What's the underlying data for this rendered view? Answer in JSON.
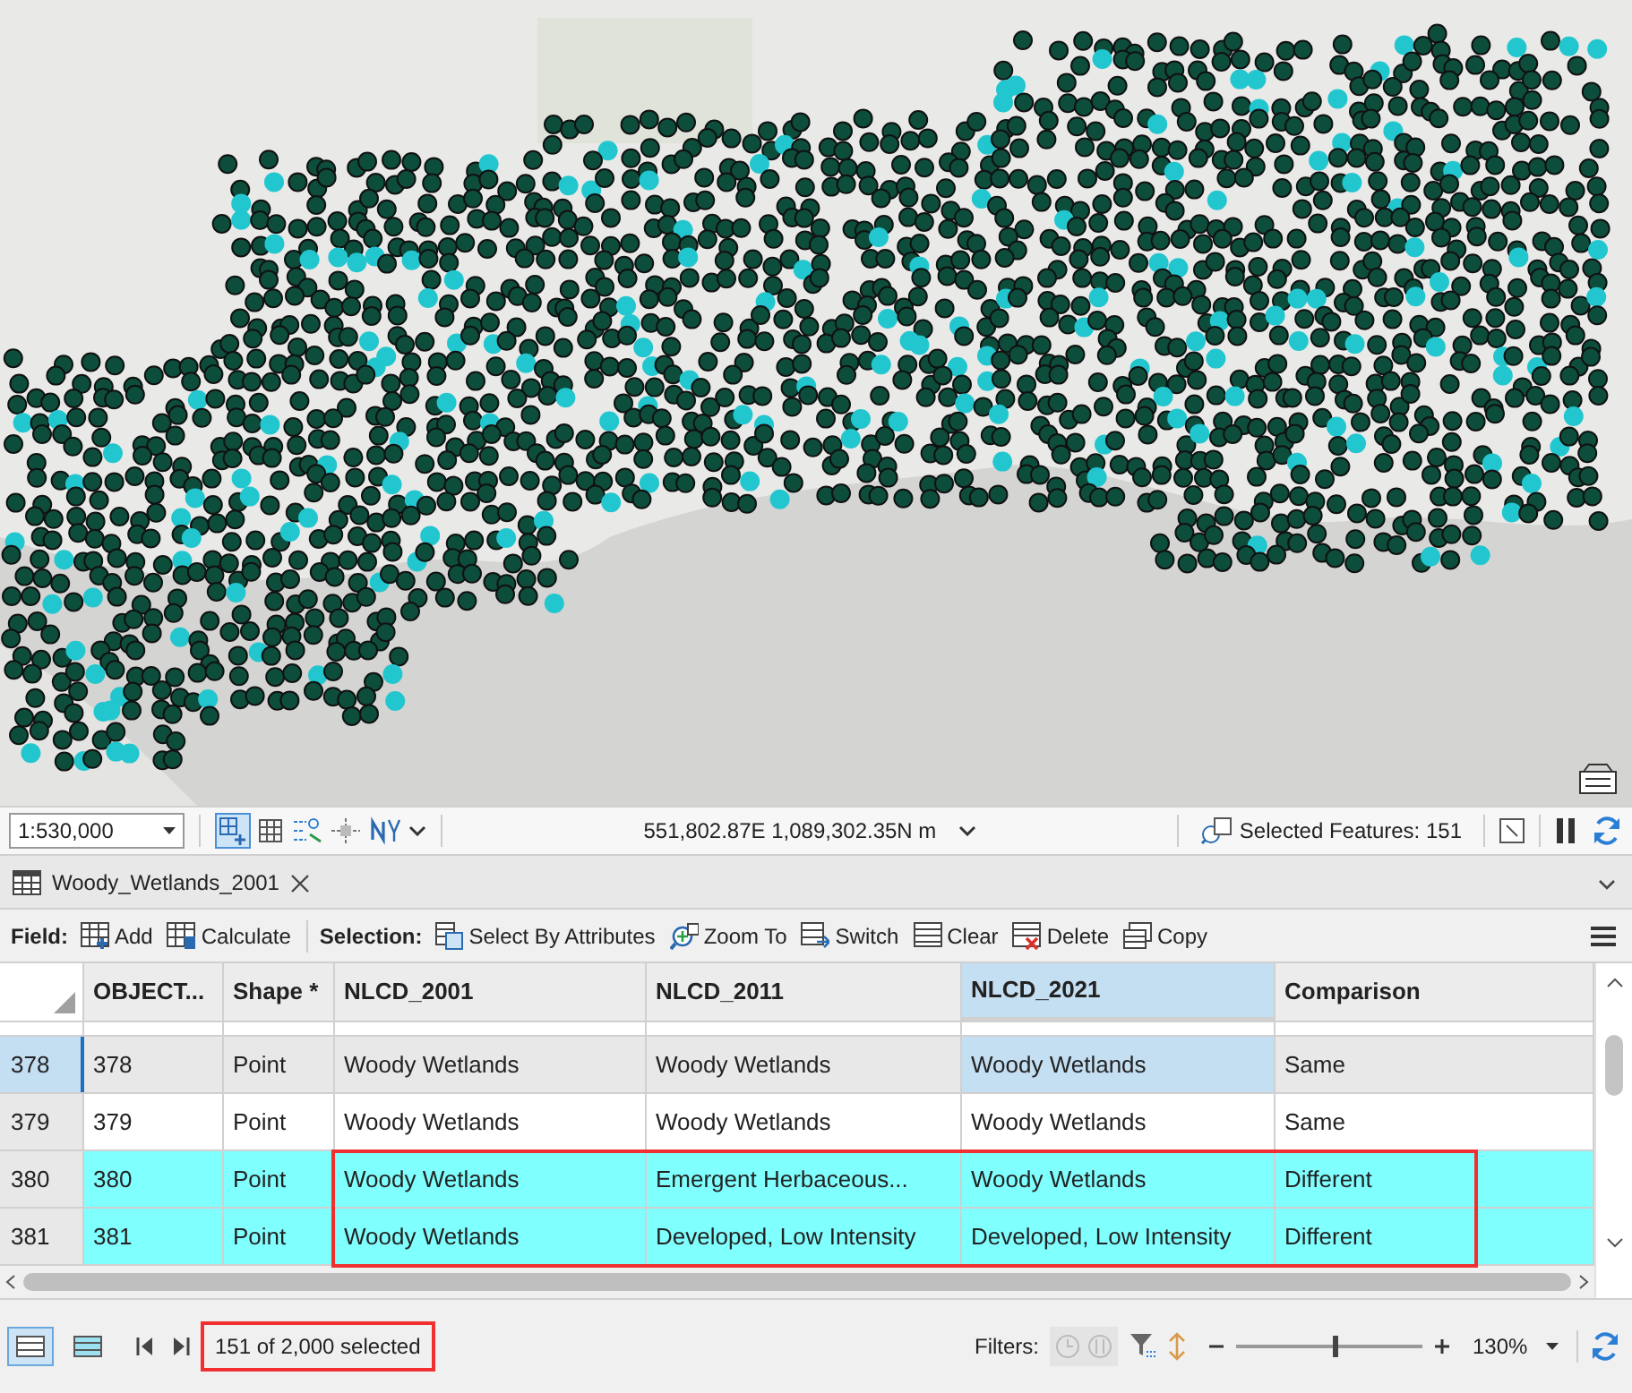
{
  "map_status": {
    "scale": "1:530,000",
    "coordinates": "551,802.87E 1,089,302.35N m",
    "selected_features": "Selected Features: 151"
  },
  "tabs": [
    {
      "label": "Woody_Wetlands_2001",
      "selected": true
    }
  ],
  "toolbar": {
    "groups": [
      {
        "label": "Field:",
        "buttons": [
          {
            "label": "Add"
          },
          {
            "label": "Calculate"
          }
        ]
      },
      {
        "label": "Selection:",
        "buttons": [
          {
            "label": "Select By Attributes"
          },
          {
            "label": "Zoom To"
          },
          {
            "label": "Switch"
          },
          {
            "label": "Clear"
          },
          {
            "label": "Delete"
          },
          {
            "label": "Copy"
          }
        ]
      }
    ]
  },
  "table": {
    "columns": [
      {
        "label": "OBJECT...",
        "selected": false
      },
      {
        "label": "Shape *",
        "selected": false
      },
      {
        "label": "NLCD_2001",
        "selected": false
      },
      {
        "label": "NLCD_2011",
        "selected": false
      },
      {
        "label": "NLCD_2021",
        "selected": true
      },
      {
        "label": "Comparison",
        "selected": false
      }
    ],
    "rows": [
      {
        "row_number": "378",
        "cells": [
          "378",
          "Point",
          "Woody Wetlands",
          "Woody Wetlands",
          "Woody Wetlands",
          "Same"
        ],
        "selected": false,
        "current": true,
        "outlined": false
      },
      {
        "row_number": "379",
        "cells": [
          "379",
          "Point",
          "Woody Wetlands",
          "Woody Wetlands",
          "Woody Wetlands",
          "Same"
        ],
        "selected": false,
        "current": false,
        "outlined": false
      },
      {
        "row_number": "380",
        "cells": [
          "380",
          "Point",
          "Woody Wetlands",
          "Emergent Herbaceous...",
          "Woody Wetlands",
          "Different"
        ],
        "selected": true,
        "current": false,
        "outlined": true
      },
      {
        "row_number": "381",
        "cells": [
          "381",
          "Point",
          "Woody Wetlands",
          "Developed, Low Intensity",
          "Developed, Low Intensity",
          "Different"
        ],
        "selected": true,
        "current": false,
        "outlined": true
      }
    ]
  },
  "status_bar": {
    "selection_text": "151 of 2,000 selected",
    "outlined": true,
    "filters_label": "Filters:",
    "zoom": {
      "level": 0.53,
      "reading": "130%"
    }
  }
}
